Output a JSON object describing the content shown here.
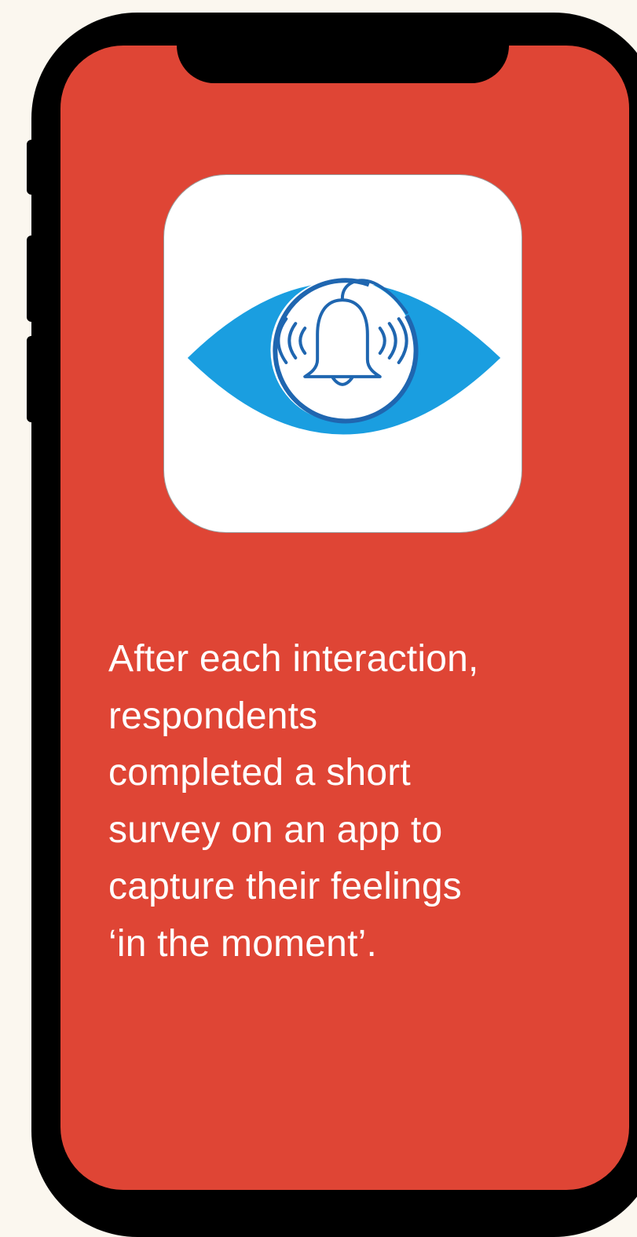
{
  "colors": {
    "background": "#fbf7ef",
    "phone_frame": "#000000",
    "screen": "#df4535",
    "icon_background": "#ffffff",
    "eye_blue": "#1a9ee0",
    "ring_blue": "#1f66b0"
  },
  "app_icon": {
    "icon": "eye-bell-icon"
  },
  "caption": {
    "lines": [
      "After each interaction,",
      "respondents",
      "completed a short",
      "survey on an app to",
      "capture their feelings",
      "‘in the moment’."
    ]
  }
}
